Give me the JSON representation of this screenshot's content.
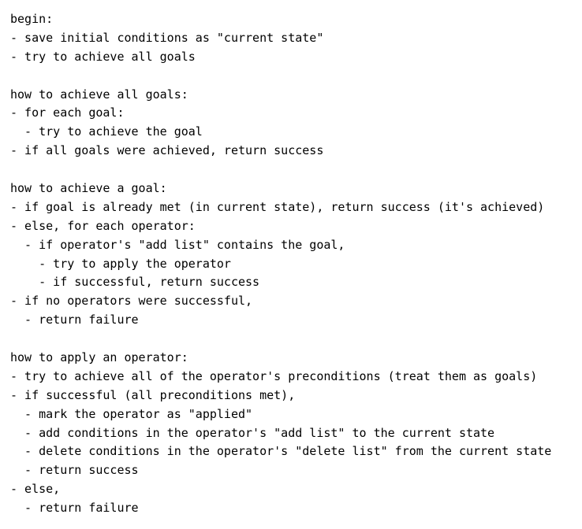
{
  "lines": [
    "begin:",
    "- save initial conditions as \"current state\"",
    "- try to achieve all goals",
    "",
    "how to achieve all goals:",
    "- for each goal:",
    "  - try to achieve the goal",
    "- if all goals were achieved, return success",
    "",
    "how to achieve a goal:",
    "- if goal is already met (in current state), return success (it's achieved)",
    "- else, for each operator:",
    "  - if operator's \"add list\" contains the goal,",
    "    - try to apply the operator",
    "    - if successful, return success",
    "- if no operators were successful,",
    "  - return failure",
    "",
    "how to apply an operator:",
    "- try to achieve all of the operator's preconditions (treat them as goals)",
    "- if successful (all preconditions met),",
    "  - mark the operator as \"applied\"",
    "  - add conditions in the operator's \"add list\" to the current state",
    "  - delete conditions in the operator's \"delete list\" from the current state",
    "  - return success",
    "- else,",
    "  - return failure"
  ]
}
